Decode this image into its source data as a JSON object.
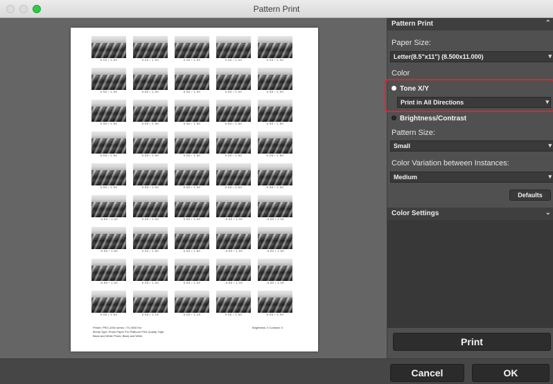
{
  "window": {
    "title": "Pattern Print"
  },
  "preview": {
    "rows": [
      [
        "0.00 / 1.00",
        "0.00 / 1.00",
        "0.00 / 1.00",
        "0.00 / 1.00",
        "0.00 / 1.00"
      ],
      [
        "0.50 / 1.00",
        "0.50 / 1.00",
        "0.50 / 1.00",
        "0.50 / 1.00",
        "0.50 / 1.00"
      ],
      [
        "0.50 / 1.50",
        "0.50 / 1.50",
        "0.50 / 1.50",
        "0.50 / 1.50",
        "0.50 / 1.50"
      ],
      [
        "0.00 / 1.50",
        "0.00 / 1.50",
        "0.00 / 1.50",
        "0.00 / 1.50",
        "0.00 / 1.50"
      ],
      [
        "0.50 / 1.00",
        "0.50 / 1.00",
        "0.50 / 1.00",
        "0.50 / 1.00",
        "0.50 / 1.00"
      ],
      [
        "-0.50 / 1.00",
        "0.00 / 1.00",
        "0.50 / 1.00",
        "-0.50 / 1.00",
        "-0.50 / 1.00"
      ],
      [
        "-0.50 / 1.50",
        "0.00 / 1.50",
        "0.50 / 1.50",
        "-0.50 / 1.50",
        "-0.50 / 1.50"
      ],
      [
        "-0.50 / 1.00",
        "0.00 / 1.00",
        "0.50 / 1.00",
        "-0.50 / 1.00",
        "-0.50 / 1.00"
      ],
      [
        "0.00 / 1.00",
        "0.00 / 1.15",
        "0.00 / 1.15",
        "0.00 / 1.00",
        "0.00 / 1.00"
      ]
    ],
    "footer_left": "Printer: PRO-1000 series / TX-3000 Ext\nMedia Type: Photo Paper Pro Platinum  Print Quality: High\nBlack and White Photo: Black and White",
    "footer_right": "Brightness: 0  Contrast: 0"
  },
  "panel": {
    "section_title": "Pattern Print",
    "paper_size_label": "Paper Size:",
    "paper_size_value": "Letter(8.5\"x11\") (8.500x11.000)",
    "color_label": "Color",
    "tone_label": "Tone X/Y",
    "direction_value": "Print in All Directions",
    "brightness_label": "Brightness/Contrast",
    "pattern_size_label": "Pattern Size:",
    "pattern_size_value": "Small",
    "variation_label": "Color Variation between Instances:",
    "variation_value": "Medium",
    "defaults_label": "Defaults",
    "color_settings_title": "Color Settings",
    "print_label": "Print"
  },
  "bottom": {
    "cancel_label": "Cancel",
    "ok_label": "OK"
  },
  "colors": {
    "highlight": "#e8212b",
    "zoom_light": "#2ecb44"
  }
}
